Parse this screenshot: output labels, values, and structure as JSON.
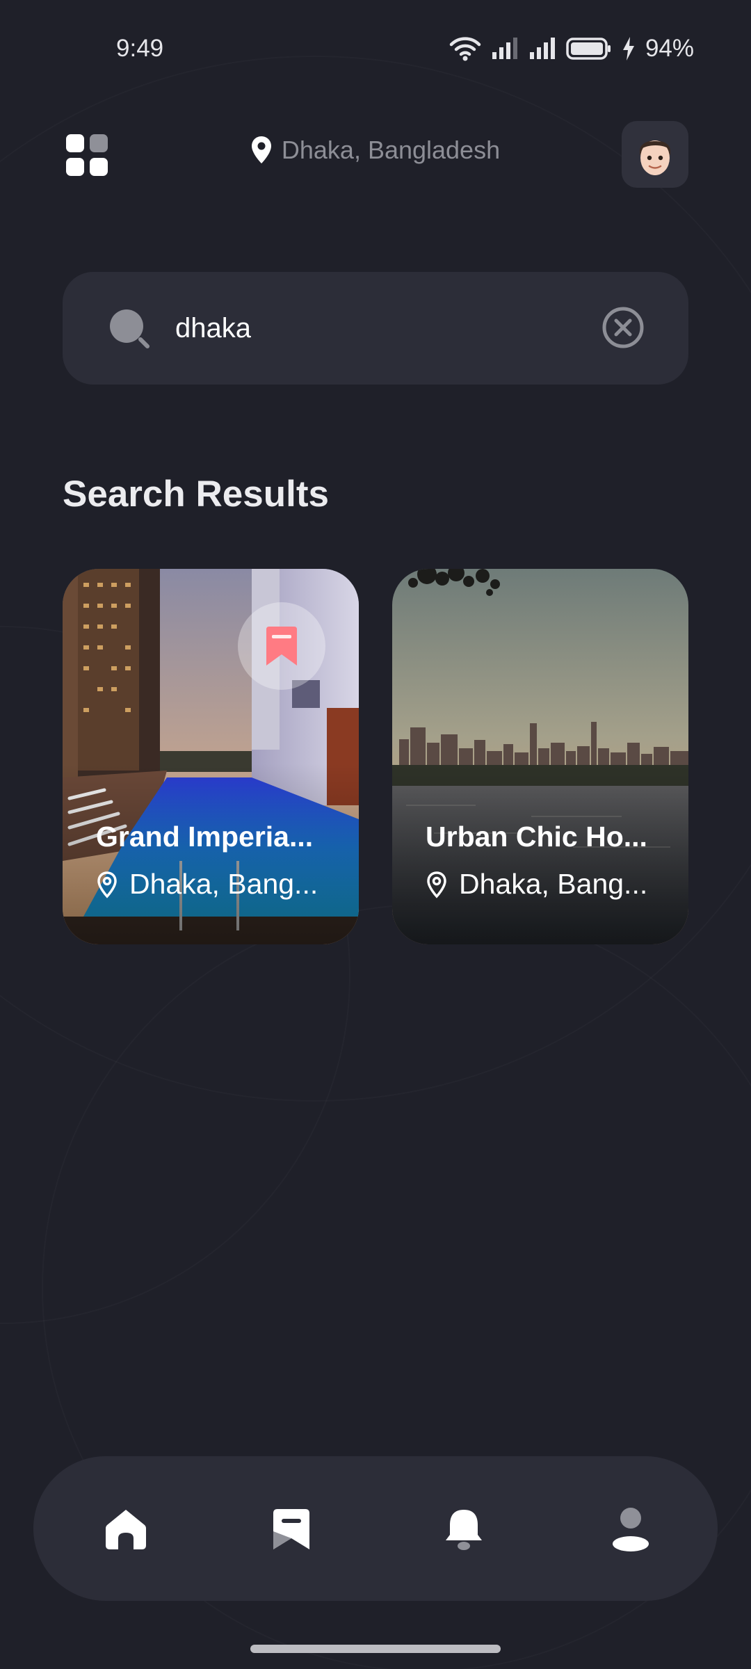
{
  "status_bar": {
    "time": "9:49",
    "battery": "94%"
  },
  "header": {
    "location": "Dhaka, Bangladesh",
    "menu_icon": "grid-menu-icon",
    "avatar_icon": "memoji-avatar"
  },
  "search": {
    "value": "dhaka",
    "placeholder": "Search"
  },
  "results": {
    "title": "Search Results",
    "items": [
      {
        "name": "Grand Imperia...",
        "location": "Dhaka, Bang..."
      },
      {
        "name": "Urban Chic Ho...",
        "location": "Dhaka, Bang..."
      }
    ]
  },
  "nav": {
    "items": [
      "home-icon",
      "bookmark-icon",
      "bell-icon",
      "user-icon"
    ]
  },
  "colors": {
    "background": "#1f2029",
    "surface": "#2c2d38",
    "accent": "#ff7b83",
    "muted": "#8d8e96"
  }
}
